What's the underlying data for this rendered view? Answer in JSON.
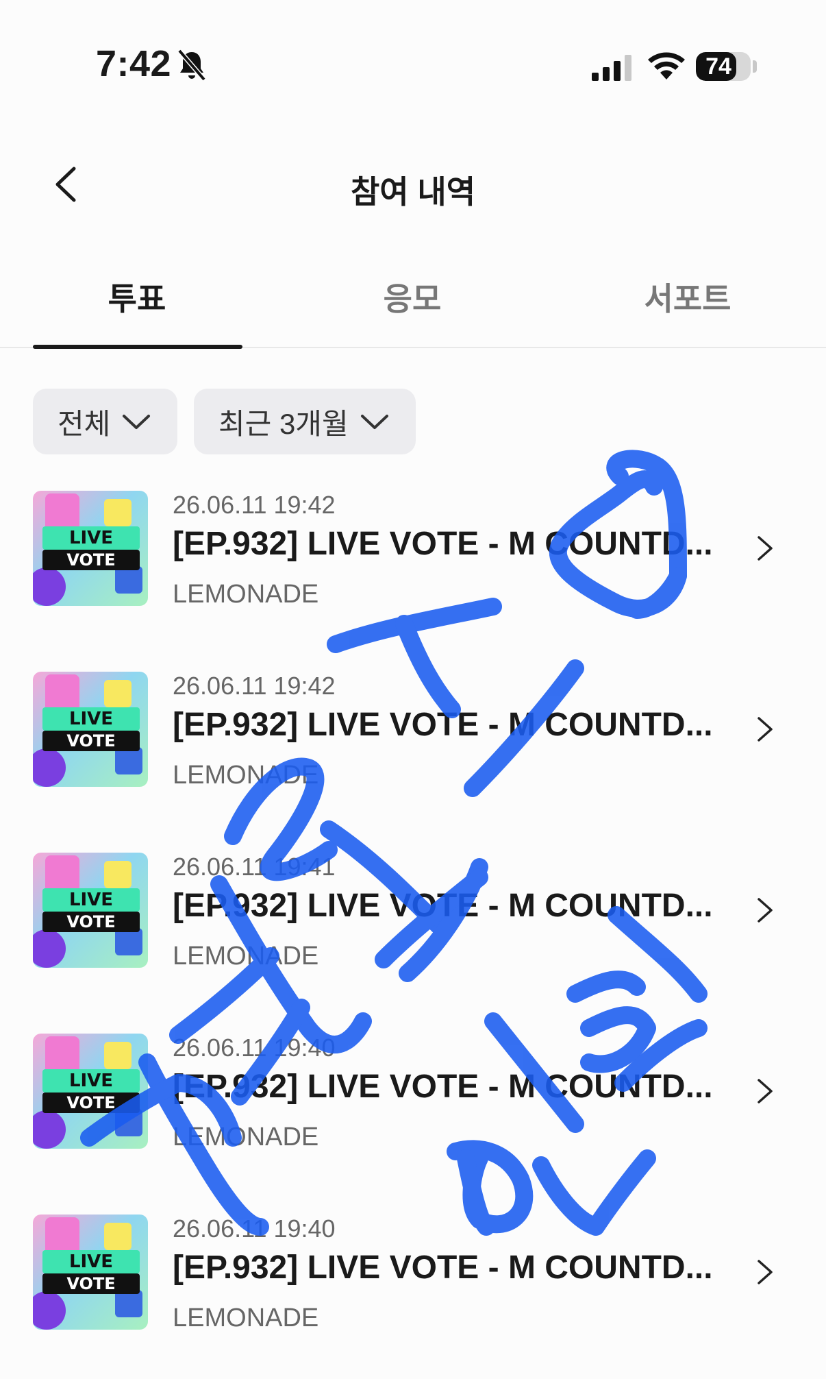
{
  "status_bar": {
    "time": "7:42",
    "battery": "74",
    "battery_level": 0.74,
    "icons": [
      "bell-muted-icon",
      "signal-icon",
      "wifi-icon",
      "battery-icon"
    ]
  },
  "header": {
    "title": "참여 내역",
    "back_icon": "chevron-left-icon"
  },
  "tabs": [
    {
      "label": "투표",
      "active": true
    },
    {
      "label": "응모",
      "active": false
    },
    {
      "label": "서포트",
      "active": false
    }
  ],
  "filters": [
    {
      "label": "전체"
    },
    {
      "label": "최근 3개월"
    }
  ],
  "items": [
    {
      "date": "26.06.11 19:42",
      "title": "[EP.932] LIVE VOTE - M COUNTD...",
      "channel": "LEMONADE",
      "thumb_text_1": "LIVE",
      "thumb_text_2": "VOTE"
    },
    {
      "date": "26.06.11 19:42",
      "title": "[EP.932] LIVE VOTE - M COUNTD...",
      "channel": "LEMONADE",
      "thumb_text_1": "LIVE",
      "thumb_text_2": "VOTE"
    },
    {
      "date": "26.06.11 19:41",
      "title": "[EP.932] LIVE VOTE - M COUNTD...",
      "channel": "LEMONADE",
      "thumb_text_1": "LIVE",
      "thumb_text_2": "VOTE"
    },
    {
      "date": "26.06.11 19:40",
      "title": "[EP.932] LIVE VOTE - M COUNTD...",
      "channel": "LEMONADE",
      "thumb_text_1": "LIVE",
      "thumb_text_2": "VOTE"
    },
    {
      "date": "26.06.11 19:40",
      "title": "[EP.932] LIVE VOTE - M COUNTD...",
      "channel": "LEMONADE",
      "thumb_text_1": "LIVE",
      "thumb_text_2": "VOTE"
    }
  ],
  "colors": {
    "scribble": "#1a5cf0",
    "text_primary": "#1a1a1a",
    "text_secondary": "#666666",
    "filter_bg": "#ececef"
  }
}
